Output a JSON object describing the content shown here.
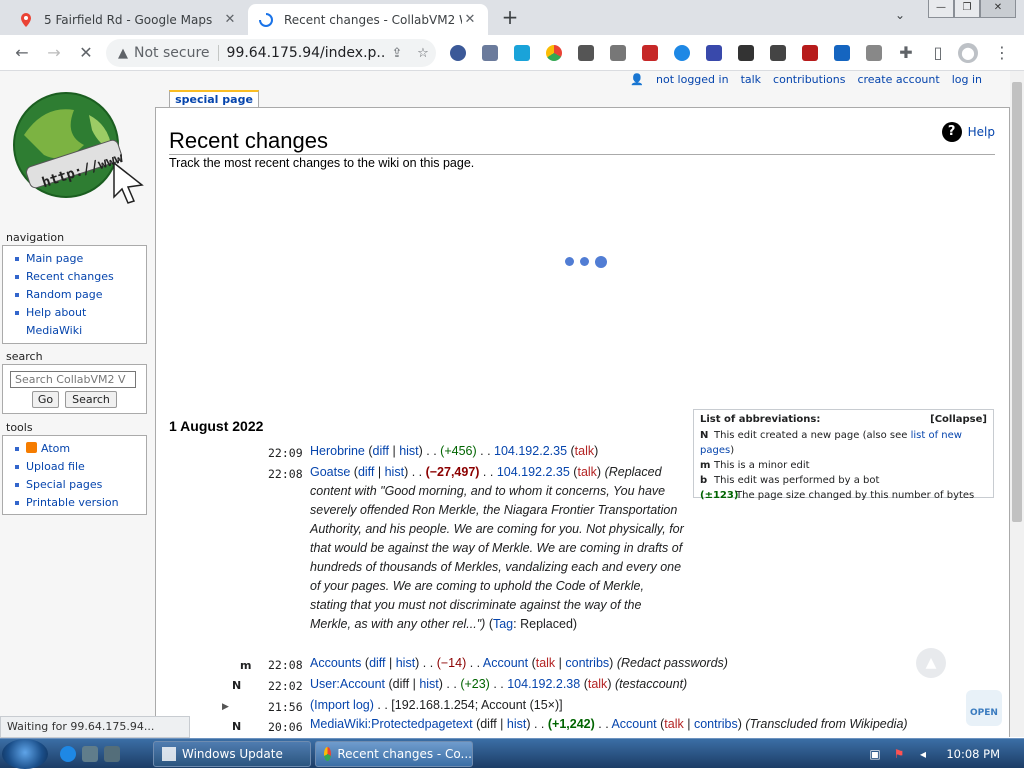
{
  "browser": {
    "tabs": [
      {
        "title": "5 Fairfield Rd - Google Maps",
        "active": false
      },
      {
        "title": "Recent changes - CollabVM2 Wiki",
        "active": true
      }
    ],
    "address": {
      "security": "Not secure",
      "url": "99.64.175.94/index.p..."
    },
    "status": "Waiting for 99.64.175.94..."
  },
  "personal": [
    "not logged in",
    "talk",
    "contributions",
    "create account",
    "log in"
  ],
  "page_tab": "special page",
  "sidebar": {
    "logo_text": "http://www",
    "navigation": {
      "heading": "navigation",
      "items": [
        "Main page",
        "Recent changes",
        "Random page",
        "Help about MediaWiki"
      ]
    },
    "search": {
      "heading": "search",
      "placeholder": "Search CollabVM2 V",
      "go": "Go",
      "search": "Search"
    },
    "tools": {
      "heading": "tools",
      "items": [
        "Atom",
        "Upload file",
        "Special pages",
        "Printable version"
      ]
    }
  },
  "main": {
    "title": "Recent changes",
    "help": "Help",
    "subtitle": "Track the most recent changes to the wiki on this page.",
    "date": "1 August 2022",
    "abbr": {
      "title": "List of abbreviations:",
      "collapse": "[Collapse]",
      "rows": [
        {
          "k": "N",
          "v": "This edit created a new page (also see ",
          "link": "list of new pages",
          "tail": ")"
        },
        {
          "k": "m",
          "v": "This is a minor edit"
        },
        {
          "k": "b",
          "v": "This edit was performed by a bot"
        },
        {
          "k": "(±123)",
          "v": "The page size changed by this number of bytes"
        }
      ]
    },
    "changes": [
      {
        "time": "22:09",
        "page": "Herobrine",
        "diff": "diff",
        "hist": "hist",
        "size": "(+456)",
        "user": "104.192.2.35",
        "talk": "talk"
      },
      {
        "time": "22:08",
        "page": "Goatse",
        "diff": "diff",
        "hist": "hist",
        "size": "(−27,497)",
        "user": "104.192.2.35",
        "talk": "talk",
        "summary": "(Replaced content with \"Good morning, and to whom it concerns, You have severely offended Ron Merkle, the Niagara Frontier Transportation Authority, and his people. We are coming for you. Not physically, for that would be against the way of Merkle. We are coming in drafts of hundreds of thousands of Merkles, vandalizing each and every one of your pages. We are coming to uphold the Code of Merkle, stating that you must not discriminate against the way of the Merkle, as with any other rel...\")",
        "tag": "Tag",
        "tag_value": "Replaced"
      },
      {
        "flag": "m",
        "time": "22:08",
        "page": "Accounts",
        "diff": "diff",
        "hist": "hist",
        "size": "(−14)",
        "user": "Account",
        "talk": "talk",
        "contribs": "contribs",
        "summary": "(Redact passwords)"
      },
      {
        "flag": "N",
        "time": "22:02",
        "page": "User:Account",
        "diff": "diff",
        "hist": "hist",
        "size": "(+23)",
        "user": "104.192.2.38",
        "talk": "talk",
        "summary": "(testaccount)"
      },
      {
        "time": "21:56",
        "page": "(Import log)",
        "detail": "[192.168.1.254; Account (15×)]"
      },
      {
        "flag": "N",
        "time": "20:06",
        "page": "MediaWiki:Protectedpagetext",
        "diff": "diff",
        "hist": "hist",
        "size": "(+1,242)",
        "user": "Account",
        "talk": "talk",
        "contribs": "contribs",
        "summary": "(Transcluded from Wikipedia)"
      }
    ]
  },
  "taskbar": {
    "items": [
      "Windows Update",
      "Recent changes - Co..."
    ],
    "clock": "10:08 PM"
  },
  "badge": "OPEN"
}
